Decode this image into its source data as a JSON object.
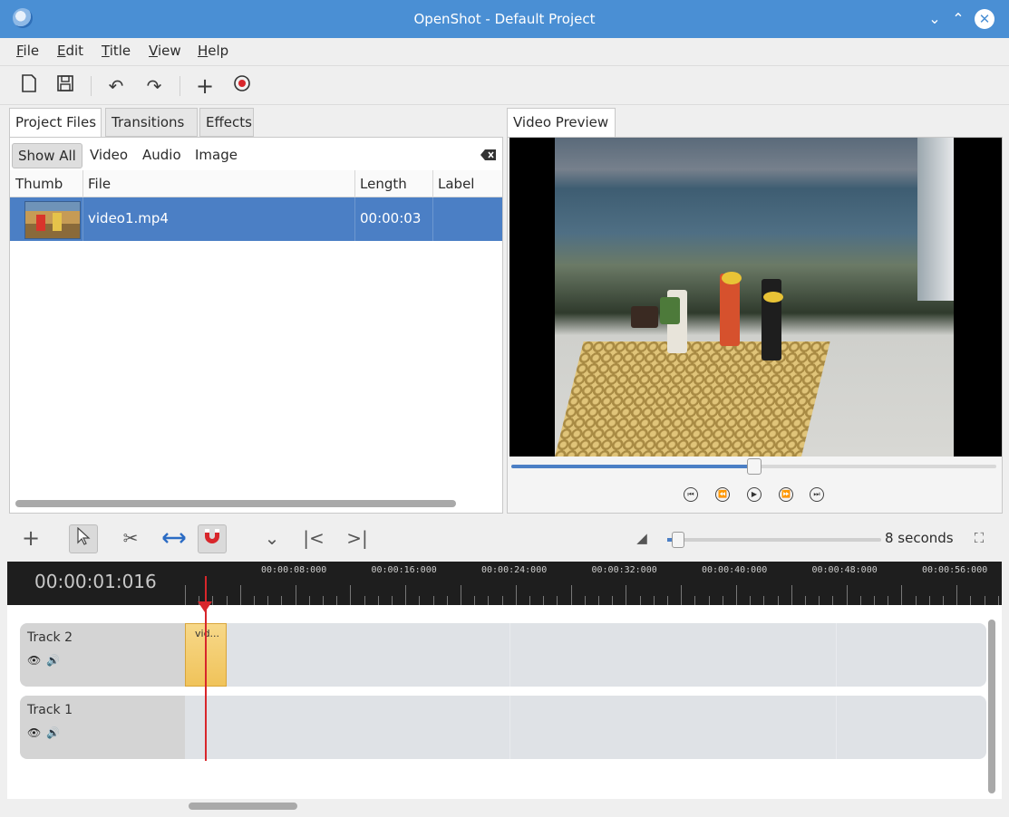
{
  "window": {
    "title": "OpenShot - Default Project"
  },
  "menu": [
    {
      "label": "File",
      "u": "F",
      "rest": "ile"
    },
    {
      "label": "Edit",
      "u": "E",
      "rest": "dit"
    },
    {
      "label": "Title",
      "u": "T",
      "rest": "itle"
    },
    {
      "label": "View",
      "u": "V",
      "rest": "iew"
    },
    {
      "label": "Help",
      "u": "H",
      "rest": "elp"
    }
  ],
  "left_tabs": [
    "Project Files",
    "Transitions",
    "Effects"
  ],
  "filters": [
    "Show All",
    "Video",
    "Audio",
    "Image"
  ],
  "file_columns": [
    "Thumb",
    "File",
    "Length",
    "Label"
  ],
  "files": [
    {
      "name": "video1.mp4",
      "length": "00:00:03",
      "label": ""
    }
  ],
  "preview": {
    "tab": "Video Preview",
    "progress": 0.5
  },
  "timeline": {
    "current_time": "00:00:01:016",
    "zoom_label": "8 seconds",
    "zoom_level": 0.03,
    "ruler_labels": [
      "00:00:08:000",
      "00:00:16:000",
      "00:00:24:000",
      "00:00:32:000",
      "00:00:40:000",
      "00:00:48:000",
      "00:00:56:000"
    ],
    "tracks": [
      {
        "name": "Track 2",
        "clip": "vid..."
      },
      {
        "name": "Track 1"
      }
    ]
  },
  "icons": {
    "playhead_color": "#d8262b",
    "selection_color": "#4b7fc5",
    "titlebar_color": "#4a8fd4"
  }
}
